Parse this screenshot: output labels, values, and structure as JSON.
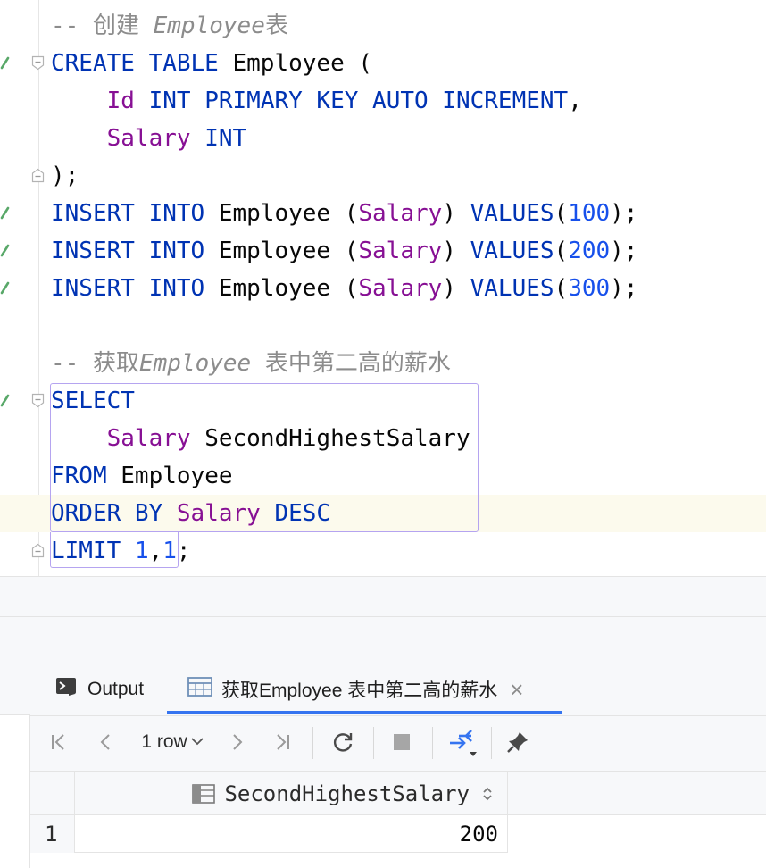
{
  "editor": {
    "lines": [
      {
        "tokens": [
          {
            "t": "-- 创建 ",
            "c": "cmt"
          },
          {
            "t": "Employee",
            "c": "cmt-i"
          },
          {
            "t": "表",
            "c": "cmt"
          }
        ]
      },
      {
        "tokens": [
          {
            "t": "CREATE TABLE",
            "c": "kw"
          },
          {
            "t": " Employee (",
            "c": ""
          }
        ]
      },
      {
        "tokens": [
          {
            "t": "    ",
            "c": ""
          },
          {
            "t": "Id",
            "c": "col"
          },
          {
            "t": " INT PRIMARY KEY AUTO_INCREMENT",
            "c": "kw"
          },
          {
            "t": ",",
            "c": ""
          }
        ]
      },
      {
        "tokens": [
          {
            "t": "    ",
            "c": ""
          },
          {
            "t": "Salary",
            "c": "col"
          },
          {
            "t": " INT",
            "c": "kw"
          }
        ]
      },
      {
        "tokens": [
          {
            "t": ");",
            "c": ""
          }
        ]
      },
      {
        "tokens": [
          {
            "t": "INSERT INTO",
            "c": "kw"
          },
          {
            "t": " Employee (",
            "c": ""
          },
          {
            "t": "Salary",
            "c": "col"
          },
          {
            "t": ") ",
            "c": ""
          },
          {
            "t": "VALUES",
            "c": "kw"
          },
          {
            "t": "(",
            "c": ""
          },
          {
            "t": "100",
            "c": "num"
          },
          {
            "t": ");",
            "c": ""
          }
        ]
      },
      {
        "tokens": [
          {
            "t": "INSERT INTO",
            "c": "kw"
          },
          {
            "t": " Employee (",
            "c": ""
          },
          {
            "t": "Salary",
            "c": "col"
          },
          {
            "t": ") ",
            "c": ""
          },
          {
            "t": "VALUES",
            "c": "kw"
          },
          {
            "t": "(",
            "c": ""
          },
          {
            "t": "200",
            "c": "num"
          },
          {
            "t": ");",
            "c": ""
          }
        ]
      },
      {
        "tokens": [
          {
            "t": "INSERT INTO",
            "c": "kw"
          },
          {
            "t": " Employee (",
            "c": ""
          },
          {
            "t": "Salary",
            "c": "col"
          },
          {
            "t": ") ",
            "c": ""
          },
          {
            "t": "VALUES",
            "c": "kw"
          },
          {
            "t": "(",
            "c": ""
          },
          {
            "t": "300",
            "c": "num"
          },
          {
            "t": ");",
            "c": ""
          }
        ]
      },
      {
        "tokens": []
      },
      {
        "tokens": [
          {
            "t": "-- 获取",
            "c": "cmt"
          },
          {
            "t": "Employee",
            "c": "cmt-i"
          },
          {
            "t": " 表中第二高的薪水",
            "c": "cmt"
          }
        ]
      },
      {
        "tokens": [
          {
            "t": "SELECT",
            "c": "kw"
          }
        ]
      },
      {
        "tokens": [
          {
            "t": "    ",
            "c": ""
          },
          {
            "t": "Salary",
            "c": "col"
          },
          {
            "t": " SecondHighestSalary",
            "c": ""
          }
        ]
      },
      {
        "tokens": [
          {
            "t": "FROM",
            "c": "kw"
          },
          {
            "t": " Employee",
            "c": ""
          }
        ]
      },
      {
        "tokens": [
          {
            "t": "ORDER BY",
            "c": "kw"
          },
          {
            "t": " ",
            "c": ""
          },
          {
            "t": "Salary",
            "c": "col"
          },
          {
            "t": " DESC",
            "c": "kw"
          }
        ]
      },
      {
        "tokens": [
          {
            "t": "LIMIT",
            "c": "kw"
          },
          {
            "t": " ",
            "c": ""
          },
          {
            "t": "1",
            "c": "num"
          },
          {
            "t": ",",
            "c": ""
          },
          {
            "t": "1",
            "c": "num"
          },
          {
            "t": ";",
            "c": ""
          }
        ]
      }
    ],
    "run_markers_on_lines": [
      1,
      5,
      6,
      7,
      10
    ],
    "fold_open_lines": [
      1,
      10
    ],
    "fold_close_lines": [
      4,
      14
    ]
  },
  "panel": {
    "tabs": [
      {
        "label": "Output",
        "icon": "console-icon"
      },
      {
        "label": "获取Employee 表中第二高的薪水",
        "icon": "table-icon",
        "active": true
      }
    ],
    "toolbar": {
      "row_count": "1 row"
    },
    "grid": {
      "columns": [
        "SecondHighestSalary"
      ],
      "rows": [
        {
          "num": "1",
          "values": [
            "200"
          ]
        }
      ]
    }
  },
  "colors": {
    "keyword": "#0033b3",
    "column": "#871094",
    "number": "#1750eb",
    "comment": "#8c8c8c",
    "selection_outline": "#b5a4f0",
    "run_marker": "#59a869",
    "tab_underline": "#3574f0"
  }
}
